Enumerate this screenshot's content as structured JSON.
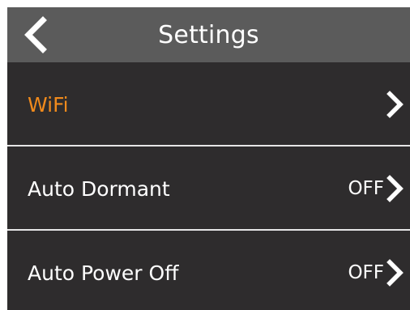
{
  "header": {
    "title": "Settings",
    "back_icon": "chevron-left-icon"
  },
  "menu": {
    "items": [
      {
        "label": "WiFi",
        "value": "",
        "highlighted": true,
        "icon": "chevron-right-icon"
      },
      {
        "label": "Auto Dormant",
        "value": "OFF",
        "highlighted": false,
        "icon": "chevron-right-icon"
      },
      {
        "label": "Auto Power Off",
        "value": "OFF",
        "highlighted": false,
        "icon": "chevron-right-icon"
      }
    ]
  },
  "colors": {
    "background": "#2e2c2d",
    "header_background": "#5b5b5b",
    "text": "#ffffff",
    "highlight": "#f08a1c",
    "divider": "#e6e6e6"
  }
}
